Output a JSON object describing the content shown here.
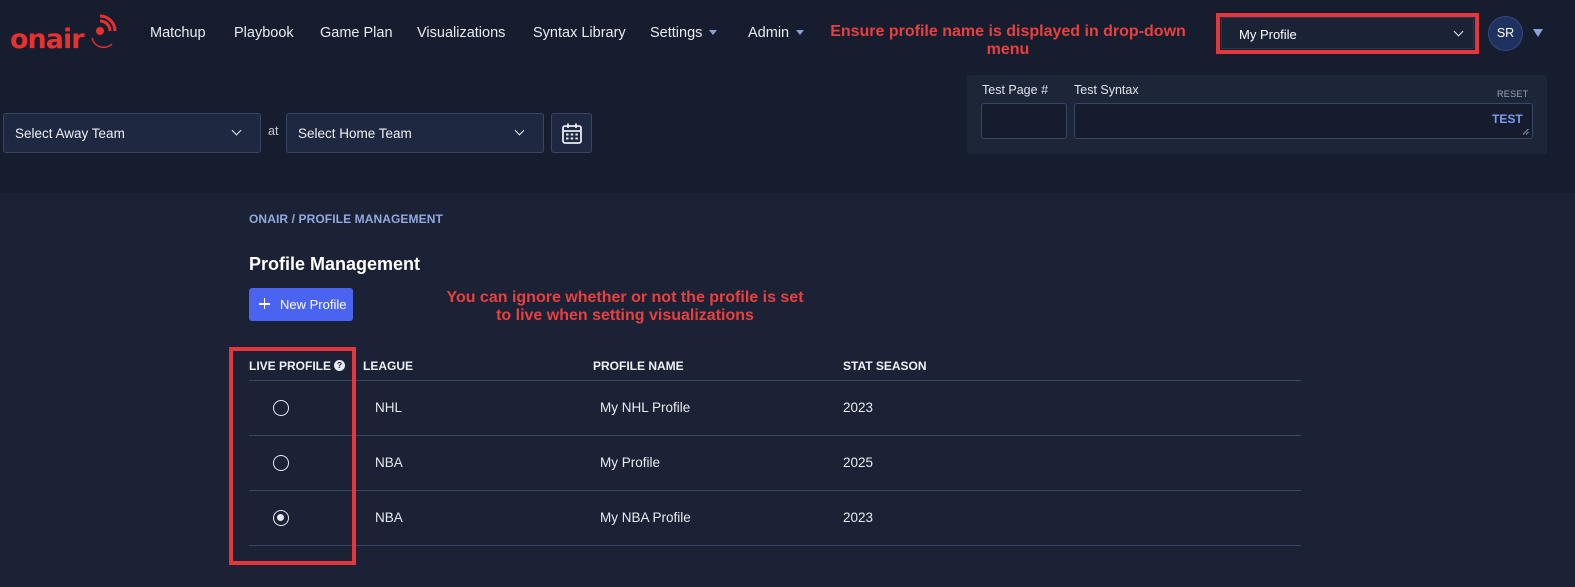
{
  "header": {
    "logo_text": "onair",
    "nav": [
      {
        "label": "Matchup"
      },
      {
        "label": "Playbook"
      },
      {
        "label": "Game Plan"
      },
      {
        "label": "Visualizations"
      },
      {
        "label": "Syntax Library"
      },
      {
        "label": "Settings",
        "has_dropdown": true
      },
      {
        "label": "Admin",
        "has_dropdown": true
      }
    ],
    "profile_select": {
      "value": "My Profile"
    },
    "avatar_initials": "SR"
  },
  "annotations": {
    "profile_note": "Ensure profile name is displayed in drop-down menu",
    "live_note": "You can ignore whether or not the profile is set to live when setting visualizations"
  },
  "matchup_bar": {
    "away_select": "Select Away Team",
    "at_label": "at",
    "home_select": "Select Home Team",
    "calendar_icon": "calendar-icon"
  },
  "test_panel": {
    "page_label": "Test Page #",
    "syntax_label": "Test Syntax",
    "reset_label": "RESET",
    "test_button": "TEST"
  },
  "main": {
    "breadcrumb": "ONAIR / PROFILE MANAGEMENT",
    "title": "Profile Management",
    "new_button": "New Profile",
    "table": {
      "headers": [
        "LIVE PROFILE",
        "LEAGUE",
        "PROFILE NAME",
        "STAT SEASON"
      ],
      "rows": [
        {
          "live": false,
          "league": "NHL",
          "name": "My NHL Profile",
          "season": "2023"
        },
        {
          "live": false,
          "league": "NBA",
          "name": "My Profile",
          "season": "2025"
        },
        {
          "live": true,
          "league": "NBA",
          "name": "My NBA Profile",
          "season": "2023"
        }
      ]
    }
  },
  "colors": {
    "background": "#1b2236",
    "topbar": "#161d2e",
    "accent_button": "#4a63f0",
    "annotation_red": "#e8403f",
    "logo_red": "#e8302f"
  }
}
